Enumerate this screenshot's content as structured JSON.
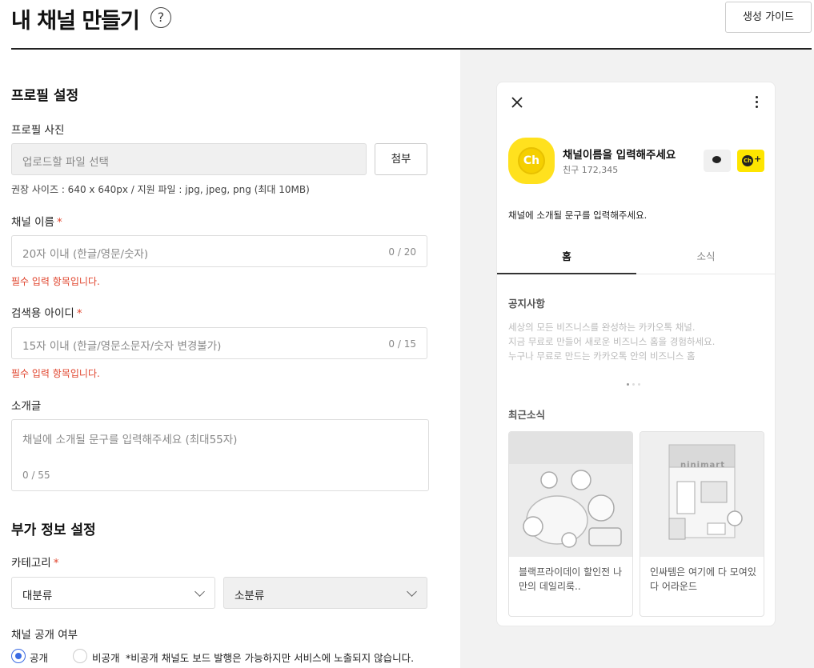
{
  "header": {
    "title": "내 채널 만들기",
    "help_symbol": "?",
    "guide_button": "생성 가이드"
  },
  "profile": {
    "section_title": "프로필 설정",
    "photo_label": "프로필 사진",
    "upload_placeholder": "업로드할 파일 선택",
    "attach_button": "첨부",
    "photo_hint": "권장 사이즈 : 640 x 640px / 지원 파일 : jpg, jpeg, png (최대 10MB)",
    "name_label": "채널 이름",
    "name_placeholder": "20자 이내 (한글/영문/숫자)",
    "name_count": "0 / 20",
    "name_error": "필수 입력 항목입니다.",
    "id_label": "검색용 아이디",
    "id_placeholder": "15자 이내 (한글/영문소문자/숫자 변경불가)",
    "id_count": "0 / 15",
    "id_error": "필수 입력 항목입니다.",
    "intro_label": "소개글",
    "intro_placeholder": "채널에 소개될 문구를 입력해주세요 (최대55자)",
    "intro_count": "0 / 55",
    "required_mark": "*"
  },
  "extra": {
    "section_title": "부가 정보 설정",
    "category_label": "카테고리",
    "category_major": "대분류",
    "category_minor": "소분류",
    "visibility_label": "채널 공개 여부",
    "public_option": "공개",
    "private_option": "비공개",
    "private_note": "*비공개 채널도 보드 발행은 가능하지만 서비스에 노출되지 않습니다."
  },
  "preview": {
    "logo_text": "Ch",
    "channel_name": "채널이름을 입력해주세요",
    "friends": "친구 172,345",
    "add_plus": "+",
    "intro": "채널에 소개될 문구를 입력해주세요.",
    "tab_home": "홈",
    "tab_news": "소식",
    "notice_title": "공지사항",
    "notice_lines": [
      "세상의 모든 비즈니스를 완성하는 카카오톡 채널.",
      "지금 무료로 만들어 새로운 비즈니스 홈을 경험하세요.",
      "누구나 무료로 만드는 카카오톡 안의 비즈니스 홈"
    ],
    "recent_title": "최근소식",
    "news": [
      {
        "text": "블랙프라이데이 할인전 나만의 데일리룩.."
      },
      {
        "text": "인싸템은 여기에 다 모여있다 어라운드",
        "store_sign": "ninimart"
      }
    ]
  },
  "colors": {
    "accent": "#3b6be3",
    "error": "#e0452e",
    "kakao_yellow": "#fee500"
  }
}
